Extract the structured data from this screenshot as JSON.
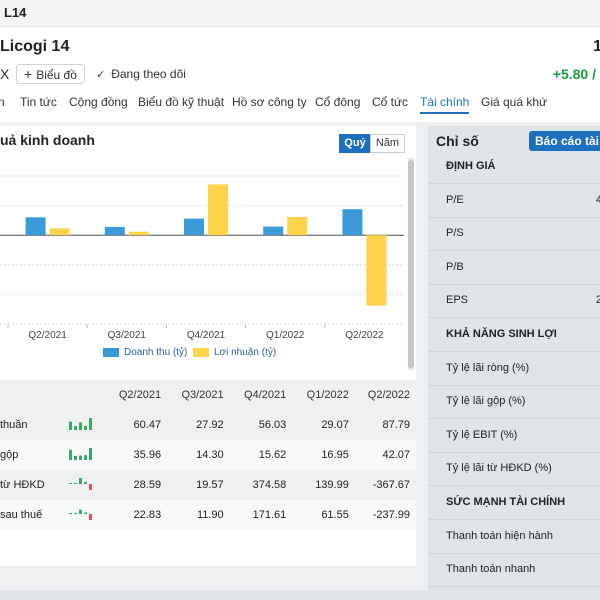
{
  "window": {
    "title": "L14"
  },
  "company": {
    "name": "Licogi 14",
    "price_fragment": "1",
    "close_symbol": "X"
  },
  "actions": {
    "chart_label": "Biểu đồ",
    "follow_label": "Đang theo dõi"
  },
  "quote": {
    "change": "+5.80 /"
  },
  "tabs": [
    {
      "label": "n",
      "active": false
    },
    {
      "label": "Tin tức",
      "active": false
    },
    {
      "label": "Cộng đồng",
      "active": false
    },
    {
      "label": "Biểu đồ kỹ thuật",
      "active": false
    },
    {
      "label": "Hồ sơ công ty",
      "active": false
    },
    {
      "label": "Cổ đông",
      "active": false
    },
    {
      "label": "Cổ tức",
      "active": false
    },
    {
      "label": "Tài chính",
      "active": true
    },
    {
      "label": "Giá quá khứ",
      "active": false
    }
  ],
  "results": {
    "title": "uả kinh doanh",
    "period_buttons": {
      "quarter": "Quý",
      "year": "Năm"
    },
    "colors": {
      "revenue": "#3a9bd8",
      "profit": "#fdd34a",
      "accent": "#1f6fbf",
      "positive": "#1a9c3c"
    }
  },
  "chart_data": {
    "type": "bar",
    "categories": [
      "Q2/2021",
      "Q3/2021",
      "Q4/2021",
      "Q1/2022",
      "Q2/2022"
    ],
    "series": [
      {
        "name": "Doanh thu (tỷ)",
        "values": [
          60.47,
          27.92,
          56.03,
          29.07,
          87.79
        ],
        "color": "#3a9bd8"
      },
      {
        "name": "Lợi nhuận (tỷ)",
        "values": [
          22.83,
          11.9,
          171.61,
          61.55,
          -237.99
        ],
        "color": "#fdd34a"
      }
    ],
    "ylim": [
      -300,
      200
    ],
    "grid": true,
    "legend": "bottom"
  },
  "table": {
    "headers": [
      "Q2/2021",
      "Q3/2021",
      "Q4/2021",
      "Q1/2022",
      "Q2/2022"
    ],
    "rows": [
      {
        "label": "thuần",
        "values": [
          "60.47",
          "27.92",
          "56.03",
          "29.07",
          "87.79"
        ],
        "spark": [
          60.47,
          27.92,
          56.03,
          29.07,
          87.79
        ]
      },
      {
        "label": "gộp",
        "values": [
          "35.96",
          "14.30",
          "15.62",
          "16.95",
          "42.07"
        ],
        "spark": [
          35.96,
          14.3,
          15.62,
          16.95,
          42.07
        ]
      },
      {
        "label": "từ HĐKD",
        "values": [
          "28.59",
          "19.57",
          "374.58",
          "139.99",
          "-367.67"
        ],
        "spark": [
          28.59,
          19.57,
          374.58,
          139.99,
          -367.67
        ]
      },
      {
        "label": "sau thuế",
        "values": [
          "22.83",
          "11.90",
          "171.61",
          "61.55",
          "-237.99"
        ],
        "spark": [
          22.83,
          11.9,
          171.61,
          61.55,
          -237.99
        ]
      }
    ]
  },
  "indicators": {
    "title": "Chỉ số",
    "report_button": "Báo cáo tài ch",
    "rows": [
      {
        "label": "ĐỊNH GIÁ",
        "value": "",
        "head": true
      },
      {
        "label": "P/E",
        "value": "4",
        "head": false
      },
      {
        "label": "P/S",
        "value": "",
        "head": false
      },
      {
        "label": "P/B",
        "value": "",
        "head": false
      },
      {
        "label": "EPS",
        "value": "2",
        "head": false
      },
      {
        "label": "KHẢ NĂNG SINH LỢI",
        "value": "",
        "head": true
      },
      {
        "label": "Tỷ lệ lãi ròng (%)",
        "value": "",
        "head": false
      },
      {
        "label": "Tỷ lệ lãi gộp (%)",
        "value": "",
        "head": false
      },
      {
        "label": "Tỷ lệ EBIT (%)",
        "value": "",
        "head": false
      },
      {
        "label": "Tỷ lệ lãi từ HĐKD (%)",
        "value": "",
        "head": false
      },
      {
        "label": "SỨC MẠNH TÀI CHÍNH",
        "value": "",
        "head": true
      },
      {
        "label": "Thanh toán hiện hành",
        "value": "",
        "head": false
      },
      {
        "label": "Thanh toán nhanh",
        "value": "",
        "head": false
      }
    ]
  }
}
